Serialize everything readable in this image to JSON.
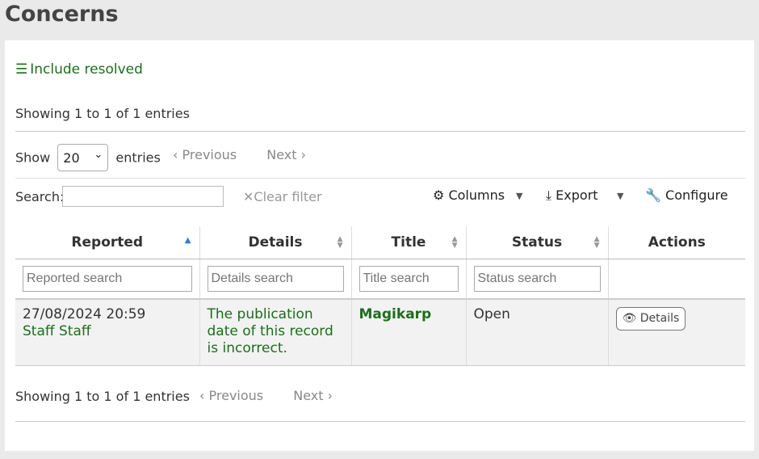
{
  "page": {
    "title": "Concerns"
  },
  "toggle": {
    "icon": "bars-icon",
    "label": "Include resolved"
  },
  "info": {
    "top": "Showing 1 to 1 of 1 entries",
    "bottom": "Showing 1 to 1 of 1 entries"
  },
  "length": {
    "prefix": "Show",
    "selected": "20",
    "suffix": "entries"
  },
  "pager": {
    "previous": "Previous",
    "next": "Next"
  },
  "search": {
    "label": "Search:",
    "value": "",
    "clear_label": "Clear filter"
  },
  "toolbar": {
    "columns_label": "Columns",
    "export_label": "Export",
    "configure_label": "Configure"
  },
  "table": {
    "headers": [
      "Reported",
      "Details",
      "Title",
      "Status",
      "Actions"
    ],
    "filters": [
      "Reported search",
      "Details search",
      "Title search",
      "Status search"
    ],
    "rows": [
      {
        "reported_date": "27/08/2024 20:59",
        "reporter": "Staff Staff",
        "details": "The publication date of this record is incorrect.",
        "title": "Magikarp",
        "status": "Open",
        "action_label": "Details"
      }
    ]
  },
  "colors": {
    "link": "#1d6d1d",
    "sort_active": "#3578c8",
    "row_bg": "#f2f2f2"
  }
}
